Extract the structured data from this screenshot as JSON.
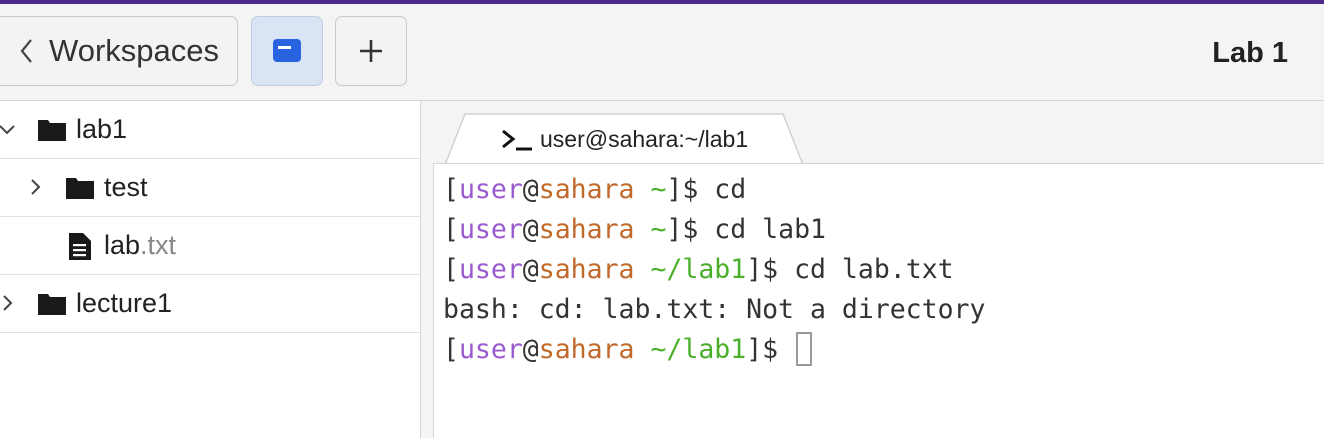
{
  "colors": {
    "accent": "#4a2a8a",
    "user": "#9b59d0",
    "host": "#c26a2b",
    "path": "#4caf2c"
  },
  "header": {
    "workspaces_label": "Workspaces",
    "title": "Lab 1",
    "workspaces_icon": "chevron-left-icon",
    "view_icon": "window-icon",
    "add_icon": "plus-icon"
  },
  "tree": {
    "items": [
      {
        "name": "lab1",
        "type": "folder",
        "expanded": true
      },
      {
        "name": "test",
        "type": "folder",
        "expanded": false
      },
      {
        "name_base": "lab",
        "name_ext": ".txt",
        "type": "file"
      },
      {
        "name": "lecture1",
        "type": "folder",
        "expanded": false
      }
    ]
  },
  "terminal": {
    "tab_label": "user@sahara:~/lab1",
    "lines": [
      {
        "open": "[",
        "user": "user",
        "at": "@",
        "host": "sahara",
        "path": " ~",
        "close": "]$ ",
        "cmd": "cd"
      },
      {
        "open": "[",
        "user": "user",
        "at": "@",
        "host": "sahara",
        "path": " ~",
        "close": "]$ ",
        "cmd": "cd lab1"
      },
      {
        "open": "[",
        "user": "user",
        "at": "@",
        "host": "sahara",
        "path": " ~/lab1",
        "close": "]$ ",
        "cmd": "cd lab.txt"
      },
      {
        "output": "bash: cd: lab.txt: Not a directory"
      },
      {
        "open": "[",
        "user": "user",
        "at": "@",
        "host": "sahara",
        "path": " ~/lab1",
        "close": "]$ ",
        "cmd": ""
      }
    ]
  }
}
